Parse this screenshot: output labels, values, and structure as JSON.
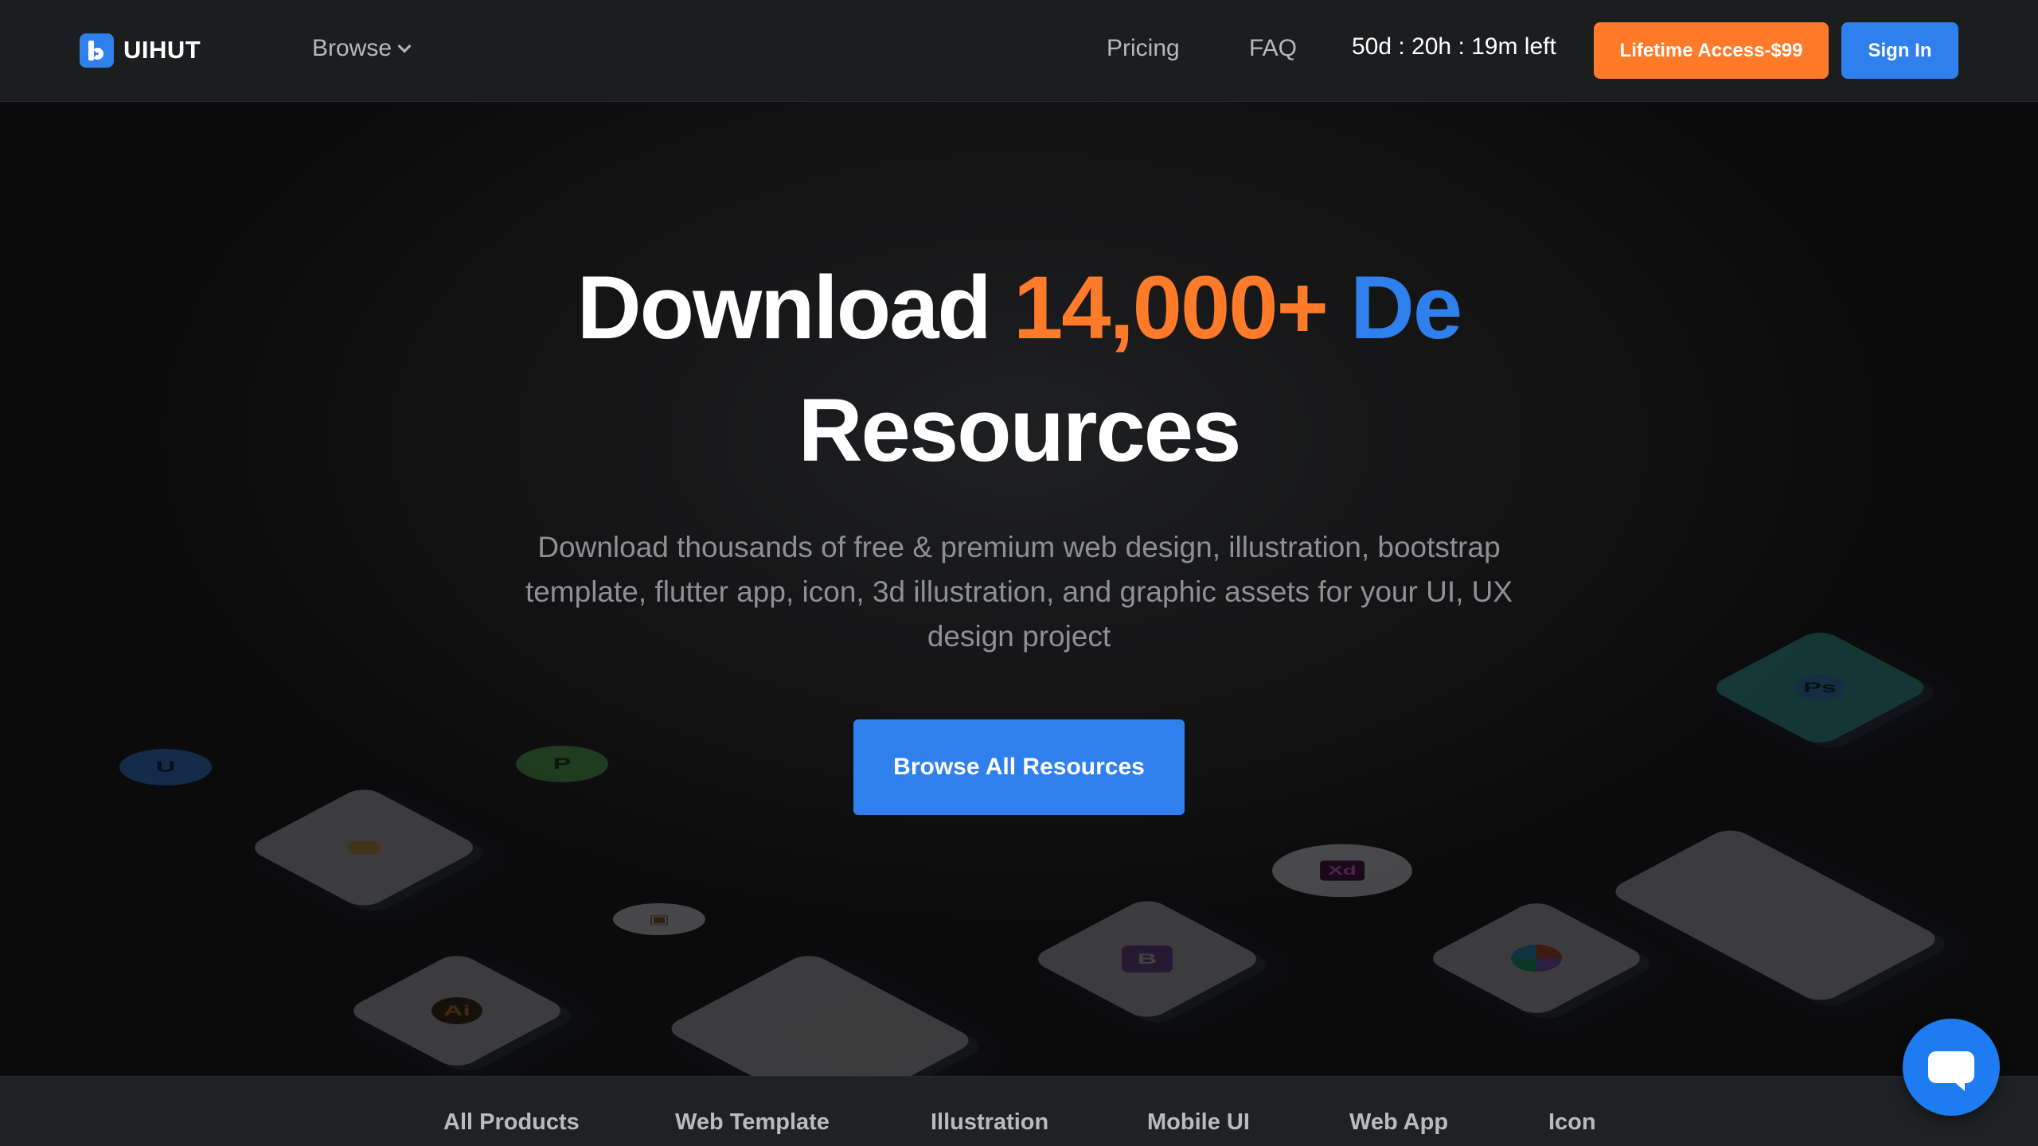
{
  "nav": {
    "logo_text": "UIHUT",
    "browse_label": "Browse",
    "pricing_label": "Pricing",
    "faq_label": "FAQ",
    "countdown": "50d : 20h : 19m left",
    "lifetime_button": "Lifetime Access-$99",
    "signin_button": "Sign In"
  },
  "hero": {
    "headline_part1": "Download",
    "headline_count": "14,000+",
    "headline_part3": "De",
    "headline_line2": "Resources",
    "subtitle": "Download thousands of free & premium web design, illustration, bootstrap template, flutter app, icon, 3d illustration, and graphic assets for your UI, UX design project",
    "cta_label": "Browse All Resources"
  },
  "decor": {
    "tile_glyphs": [
      "Ai",
      "B",
      "Xd",
      "Ps",
      "P",
      "U"
    ]
  },
  "categories": [
    "All Products",
    "Web Template",
    "Illustration",
    "Mobile UI",
    "Web App",
    "Icon"
  ],
  "colors": {
    "accent_orange": "#ff7a29",
    "accent_blue": "#2f80ed",
    "background": "#0d0d0e",
    "nav_background": "#1c1d1f"
  }
}
